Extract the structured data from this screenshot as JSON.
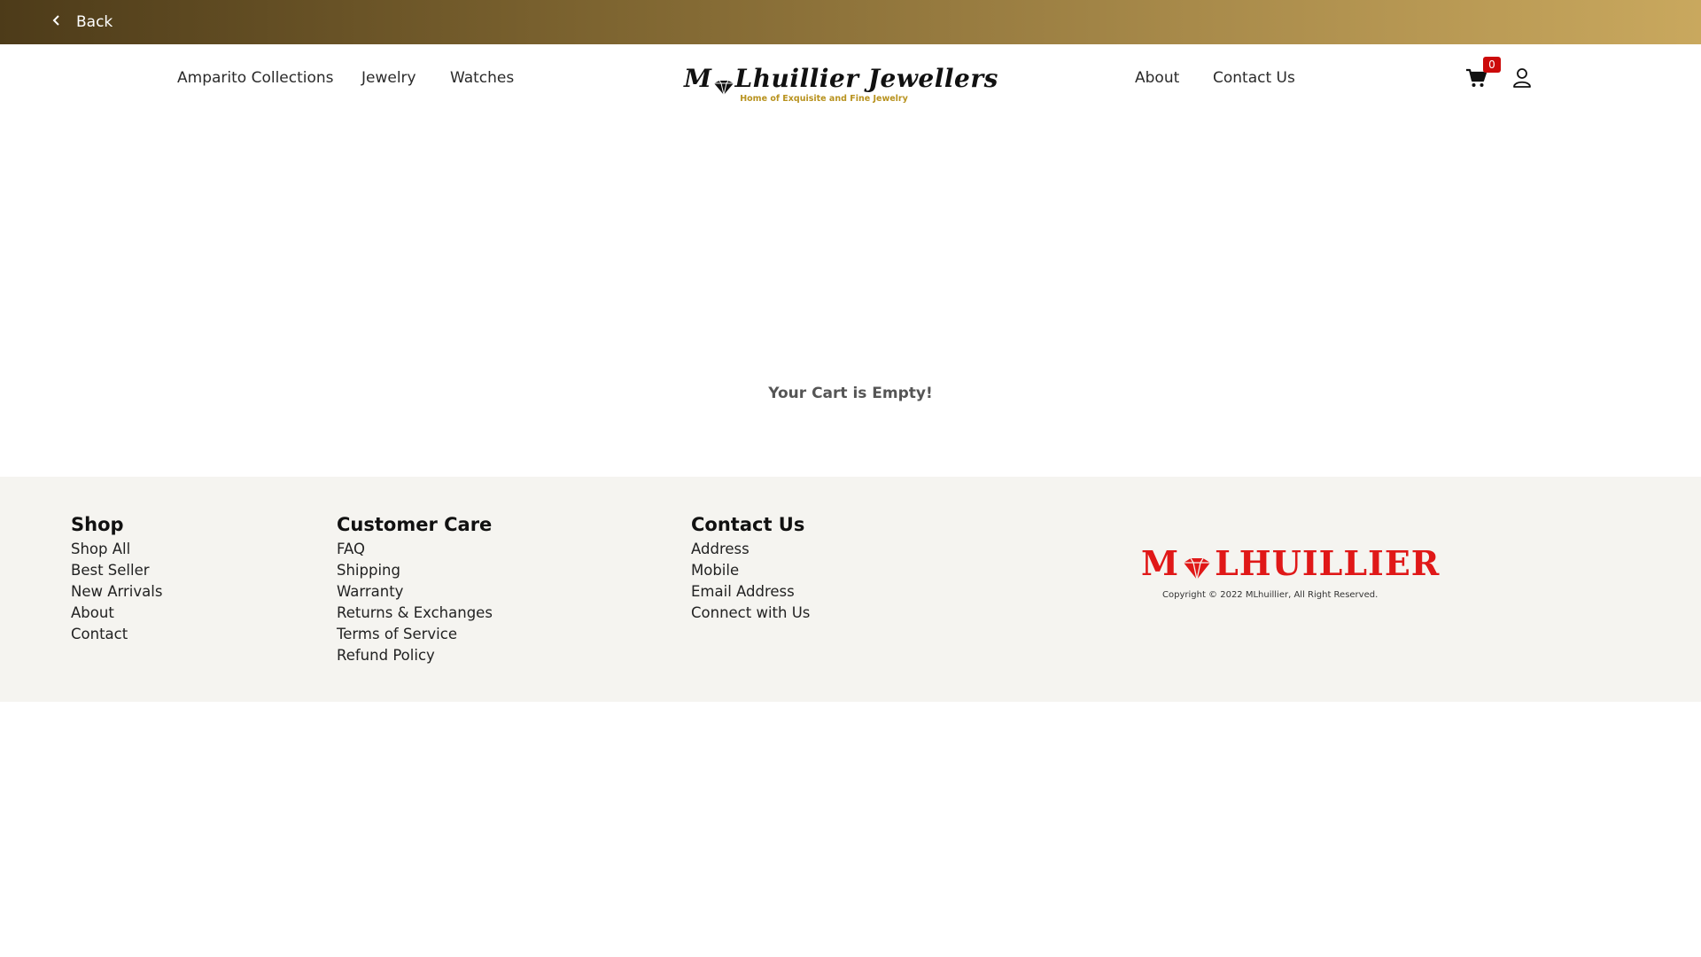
{
  "topbar": {
    "back_label": "Back"
  },
  "header": {
    "nav_left": [
      {
        "label": "Amparito Collections"
      },
      {
        "label": "Jewelry"
      },
      {
        "label": "Watches"
      }
    ],
    "logo_text_left": "M",
    "logo_text_right": "Lhuillier Jewellers",
    "logo_tagline": "Home of Exquisite and Fine Jewelry",
    "nav_right": [
      {
        "label": "About"
      },
      {
        "label": "Contact Us"
      }
    ],
    "cart_count": "0"
  },
  "main": {
    "empty_message": "Your Cart is Empty!"
  },
  "footer": {
    "columns": [
      {
        "title": "Shop",
        "links": [
          "Shop All",
          "Best Seller",
          "New Arrivals",
          "About",
          "Contact"
        ]
      },
      {
        "title": "Customer Care",
        "links": [
          "FAQ",
          "Shipping",
          "Warranty",
          "Returns & Exchanges",
          "Terms of Service",
          "Refund Policy"
        ]
      },
      {
        "title": "Contact Us",
        "links": [
          "Address",
          "Mobile",
          "Email Address",
          "Connect with Us"
        ]
      }
    ],
    "brand_left": "M",
    "brand_right": "LHUILLIER",
    "copyright": "Copyright © 2022 MLhuillier, All Right Reserved."
  },
  "colors": {
    "gradient_start": "#4d3b19",
    "gradient_end": "#c9a85e",
    "badge": "#cc0a0a",
    "brand_red": "#e01818",
    "tagline_gold": "#b8921e",
    "footer_bg": "#f5f4f0"
  },
  "icons": [
    "chevron-left-icon",
    "cart-icon",
    "user-icon",
    "diamond-heart-icon"
  ]
}
